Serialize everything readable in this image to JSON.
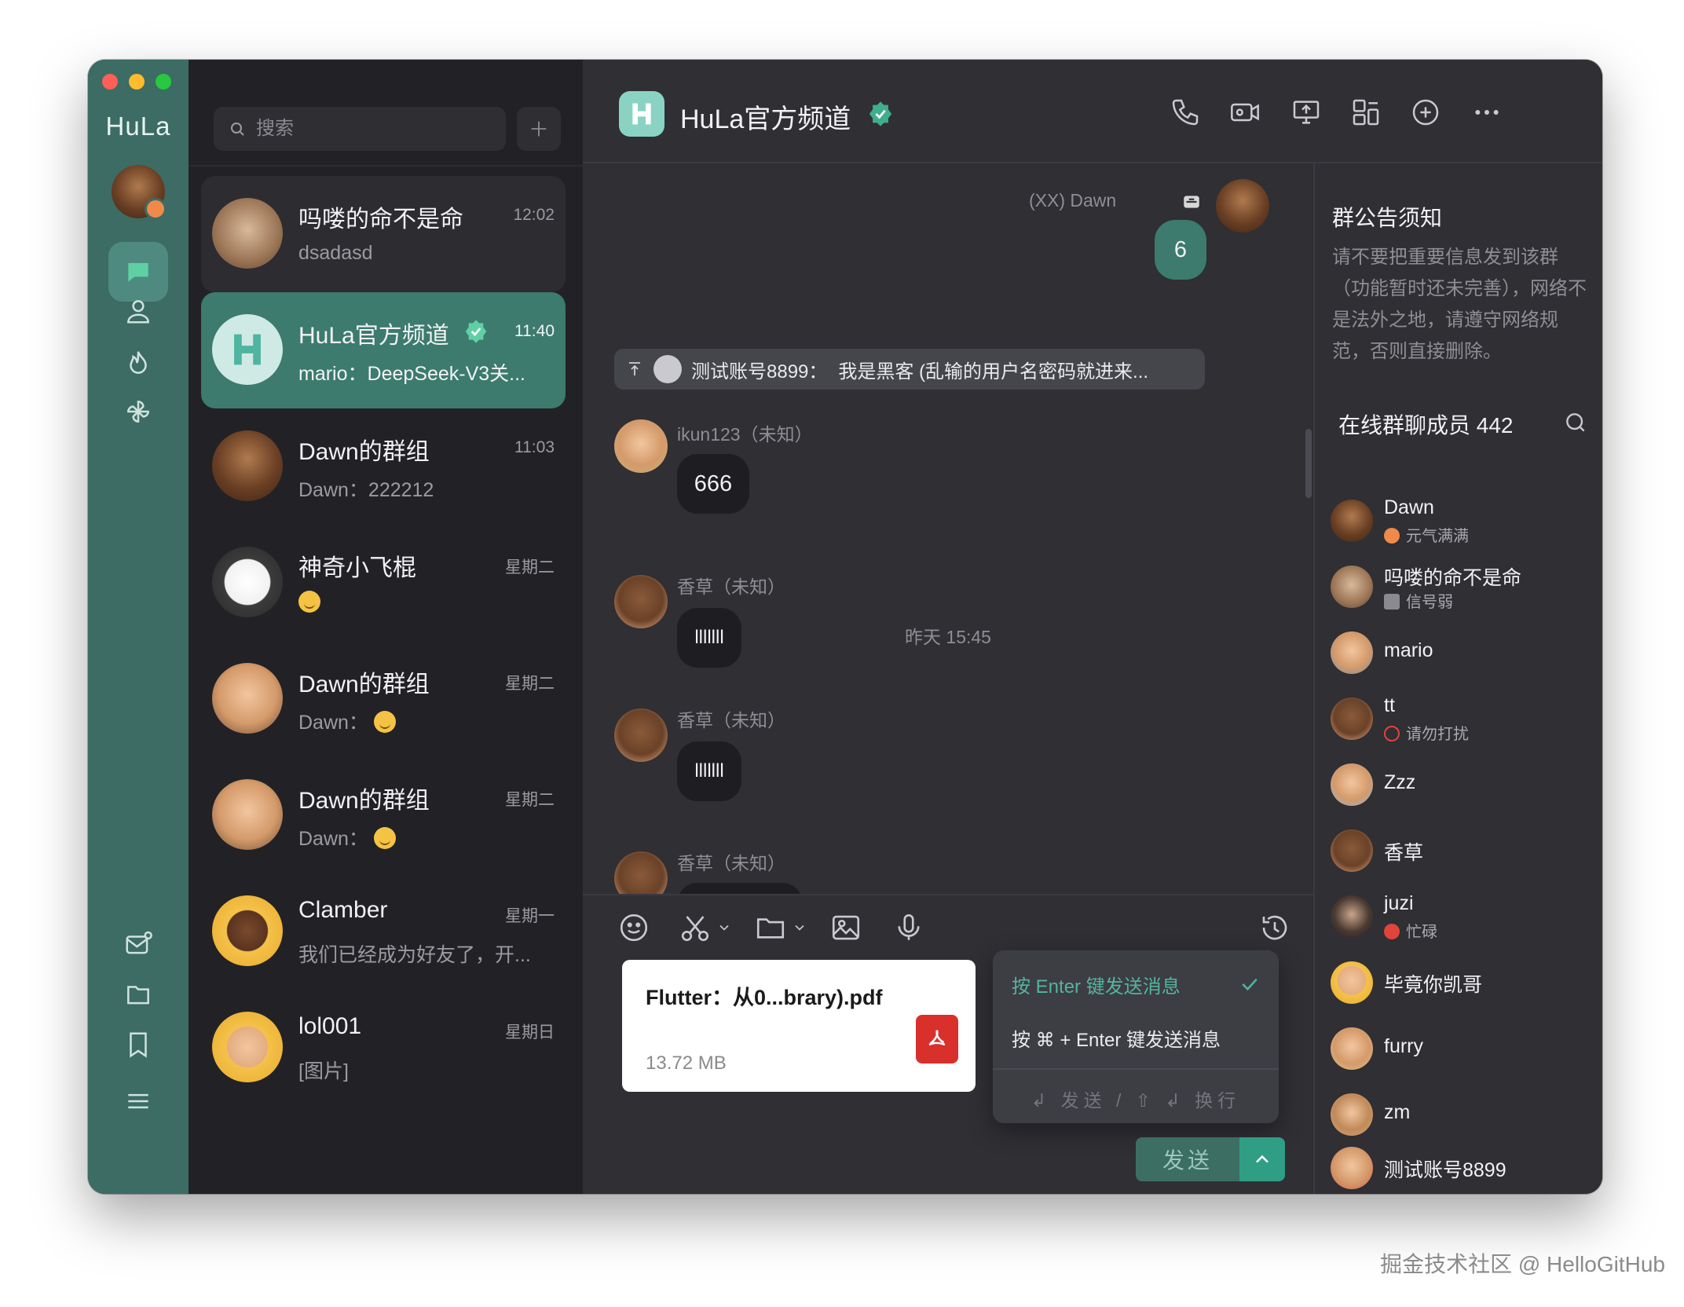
{
  "app": {
    "name": "HuLa"
  },
  "search": {
    "placeholder": "搜索"
  },
  "conversations": [
    {
      "name": "吗喽的命不是命",
      "time": "12:02",
      "preview": "dsadasd",
      "active": false
    },
    {
      "name": "HuLa官方频道",
      "time": "11:40",
      "preview": "mario：DeepSeek-V3关...",
      "active": true,
      "verified": true
    },
    {
      "name": "Dawn的群组",
      "time": "11:03",
      "preview": "Dawn：222212",
      "active": false
    },
    {
      "name": "神奇小飞棍",
      "time": "星期二",
      "preview": "",
      "active": false
    },
    {
      "name": "Dawn的群组",
      "time": "星期二",
      "preview": "Dawn：",
      "active": false
    },
    {
      "name": "Dawn的群组",
      "time": "星期二",
      "preview": "Dawn：",
      "active": false
    },
    {
      "name": "Clamber",
      "time": "星期一",
      "preview": "我们已经成为好友了，开...",
      "active": false
    },
    {
      "name": "lol001",
      "time": "星期日",
      "preview": "[图片]",
      "active": false
    }
  ],
  "chat": {
    "title": "HuLa官方频道",
    "header_icons": [
      "phone-icon",
      "video-call-icon",
      "screen-share-icon",
      "layout-icon",
      "add-circle-icon",
      "more-icon"
    ],
    "my_sender": "(XX) Dawn",
    "my_message": "6",
    "pinned": {
      "user": "测试账号8899：",
      "text": "我是黑客 (乱输的用户名密码就进来..."
    },
    "messages": [
      {
        "sender": "ikun123（未知）",
        "text": "666"
      },
      {
        "sender": "香草（未知）",
        "text": "lllllll"
      },
      {
        "sender": "香草（未知）",
        "text": "lllllll"
      },
      {
        "sender": "香草（未知）",
        "text": ""
      }
    ],
    "timestamp": "昨天 15:45"
  },
  "input": {
    "file_name": "Flutter：从0...brary).pdf",
    "file_size": "13.72 MB",
    "send_option_1": "按 Enter 键发送消息",
    "send_option_2": "按 ⌘ + Enter 键发送消息",
    "send_hint": "↲ 发送 / ⇧ ↲ 换行",
    "send_label": "发送"
  },
  "sidebar_panel": {
    "announcement_title": "群公告须知",
    "announcement_body": "请不要把重要信息发到该群（功能暂时还未完善），网络不是法外之地，请遵守网络规范，否则直接删除。",
    "members_title": "在线群聊成员 442",
    "members": [
      {
        "name": "Dawn",
        "status": "元气满满",
        "status_color": "#f08a4b"
      },
      {
        "name": "吗喽的命不是命",
        "status": "信号弱",
        "status_color": "#8a8a90"
      },
      {
        "name": "mario",
        "status": ""
      },
      {
        "name": "tt",
        "status": "请勿打扰",
        "status_color": "#e0443b"
      },
      {
        "name": "Zzz",
        "status": ""
      },
      {
        "name": "香草",
        "status": ""
      },
      {
        "name": "juzi",
        "status": "忙碌",
        "status_color": "#e0443b"
      },
      {
        "name": "毕竟你凯哥",
        "status": ""
      },
      {
        "name": "furry",
        "status": ""
      },
      {
        "name": "zm",
        "status": ""
      },
      {
        "name": "测试账号8899",
        "status": ""
      }
    ]
  },
  "watermark": "掘金技术社区 @ HelloGitHub",
  "colors": {
    "accent": "#3c7b6d",
    "rail": "#3c6c64",
    "background": "#2f2f34"
  }
}
